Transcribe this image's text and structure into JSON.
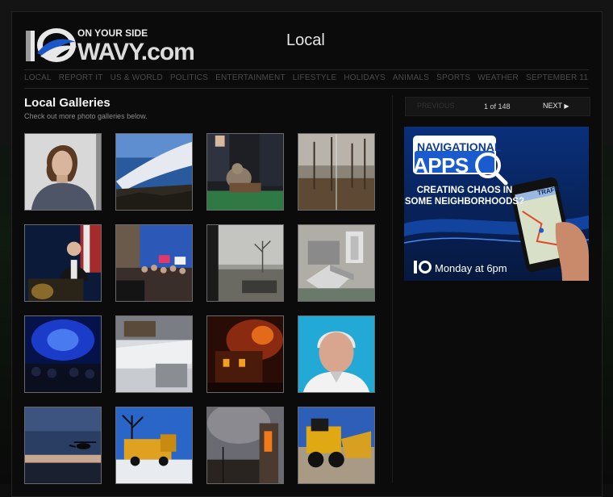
{
  "brand": {
    "logo_number": "10",
    "tagline": "ON YOUR SIDE",
    "name": "WAVY.com"
  },
  "page": {
    "title": "Local"
  },
  "nav": {
    "items": [
      "LOCAL",
      "REPORT IT",
      "US & WORLD",
      "POLITICS",
      "ENTERTAINMENT",
      "LIFESTYLE",
      "HOLIDAYS",
      "ANIMALS",
      "SPORTS",
      "WEATHER",
      "SEPTEMBER 11"
    ]
  },
  "gallery": {
    "title": "Local Galleries",
    "subtitle": "Check out more photo galleries below."
  },
  "pager": {
    "previous": "PREVIOUS",
    "count": "1 of 148",
    "next": "NEXT"
  },
  "ad": {
    "line1": "NAVIGATIONAL",
    "line2": "APPS",
    "line3": "CREATING CHAOS IN SOME NEIGHBORHOODS?",
    "app_label": "TRAFFICapp",
    "time": "Monday at 6pm"
  },
  "colors": {
    "accent_blue": "#1b5bd0",
    "nav_text": "#4a4a4a"
  }
}
